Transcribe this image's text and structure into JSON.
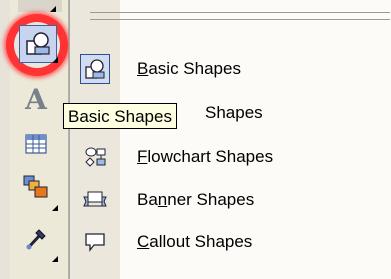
{
  "toolbox": {
    "tools": [
      {
        "icon": "basic-shapes-tool-icon",
        "selected": true,
        "highlighted": true
      },
      {
        "icon": "text-tool-icon",
        "glyph": "A"
      },
      {
        "icon": "table-tool-icon"
      },
      {
        "icon": "interactive-blend-tool-icon"
      },
      {
        "icon": "eyedropper-tool-icon"
      }
    ]
  },
  "menu": {
    "items": [
      {
        "icon": "basic-shapes-icon",
        "mnemonic": "B",
        "rest": "asic Shapes",
        "checked": true
      },
      {
        "icon": "arrow-shapes-icon",
        "visible_text": "Shapes"
      },
      {
        "icon": "flowchart-shapes-icon",
        "mnemonic": "F",
        "rest": "lowchart Shapes"
      },
      {
        "icon": "banner-shapes-icon",
        "pre": "Ba",
        "mnemonic": "n",
        "rest": "ner Shapes"
      },
      {
        "icon": "callout-shapes-icon",
        "mnemonic": "C",
        "rest": "allout Shapes"
      }
    ]
  },
  "tooltip": {
    "text": "Basic Shapes"
  },
  "colors": {
    "highlight_ring": "#ff3333",
    "tooltip_bg": "#ffffe1",
    "selection": "#c6d4ef"
  }
}
